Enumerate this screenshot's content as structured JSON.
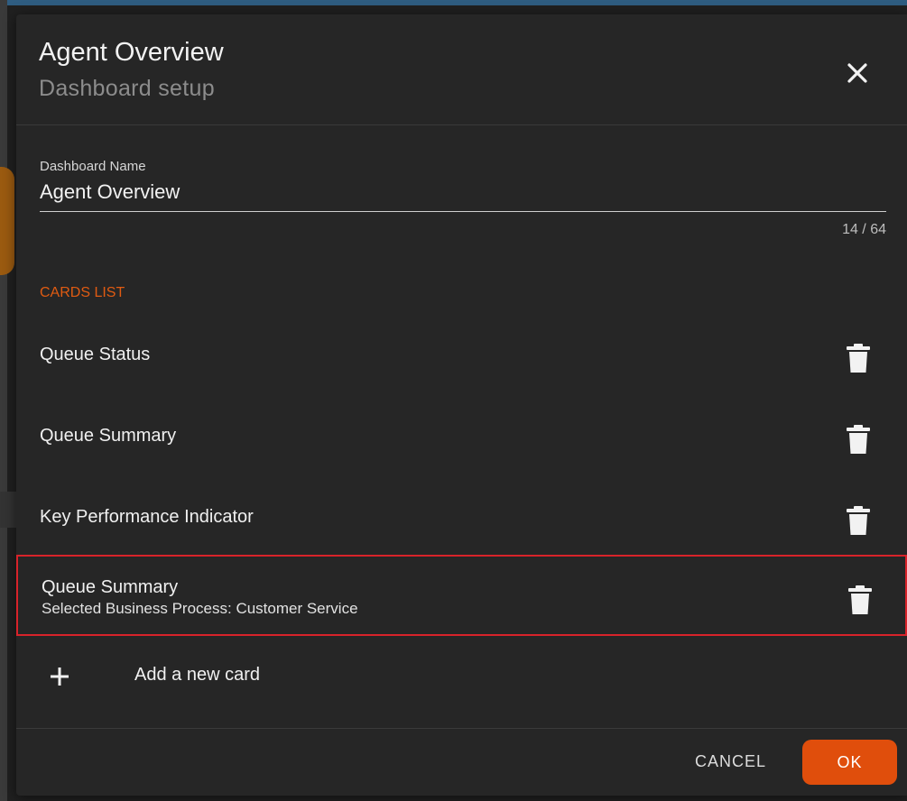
{
  "dialog": {
    "title": "Agent Overview",
    "subtitle": "Dashboard setup",
    "close_icon": "close-icon"
  },
  "field": {
    "label": "Dashboard Name",
    "value": "Agent Overview",
    "counter": "14 / 64"
  },
  "cards_section": {
    "title": "CARDS LIST",
    "items": [
      {
        "name": "Queue Status",
        "detail": ""
      },
      {
        "name": "Queue Summary",
        "detail": ""
      },
      {
        "name": "Key Performance Indicator",
        "detail": ""
      },
      {
        "name": "Queue Summary",
        "detail": "Selected Business Process: Customer Service"
      }
    ],
    "delete_icon": "trash-icon"
  },
  "add_card": {
    "label": "Add a new card",
    "icon": "plus-icon"
  },
  "footer": {
    "cancel_label": "CANCEL",
    "ok_label": "OK"
  },
  "colors": {
    "accent": "#e04e0c",
    "section_heading": "#e05b12",
    "selection_outline": "#d8232a",
    "dialog_background": "#262626"
  }
}
